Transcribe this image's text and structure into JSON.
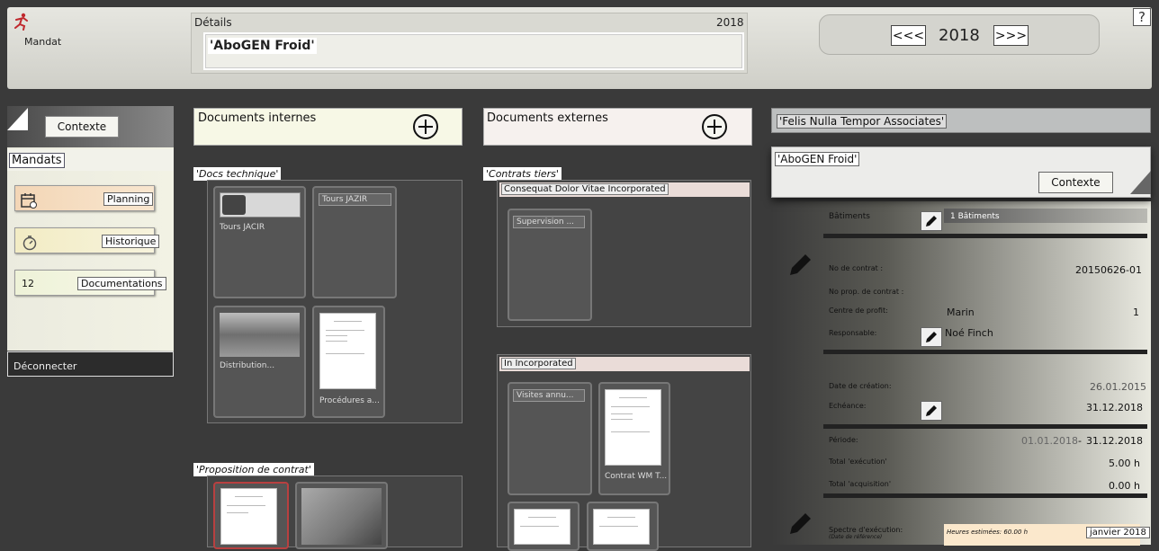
{
  "header": {
    "app_label": "Mandat",
    "details_title": "Détails",
    "details_year": "2018",
    "details_name": "'AboGEN Froid'",
    "nav_prev": "<<<",
    "nav_next": ">>>",
    "nav_year": "2018",
    "help": "?"
  },
  "sidebar": {
    "context_button": "Contexte",
    "mandats": "Mandats",
    "planning": "Planning",
    "historique": "Historique",
    "documentations_count": "12",
    "documentations": "Documentations",
    "logout": "Déconnecter"
  },
  "internal": {
    "title": "Documents internes",
    "group1": "'Docs technique'",
    "tiles": [
      "Tours JACIR",
      "Tours JAZIR",
      "Distribution...",
      "Procédures a..."
    ],
    "group2": "'Proposition de contrat'"
  },
  "external": {
    "title": "Documents externes",
    "group1": "'Contrats tiers'",
    "sub1": "Consequat Dolor Vitae Incorporated",
    "sub1_tile": "Supervision ...",
    "sub2": "In Incorporated",
    "sub2_tile1": "Visites annu...",
    "sub2_tile2": "Contrat WM T..."
  },
  "right": {
    "company": "'Felis Nulla Tempor Associates'",
    "mandate": "'AboGEN Froid'",
    "context_button": "Contexte",
    "batiments_label": "Bâtiments",
    "batiments_value": "1 Bâtiments",
    "no_contrat_label": "No de contrat :",
    "no_contrat_value": "20150626-01",
    "no_prop_label": "No prop. de contrat :",
    "centre_label": "Centre de profit:",
    "centre_name": "Marin",
    "centre_num": "1",
    "responsable_label": "Responsable:",
    "responsable_value": "Noé Finch",
    "creation_label": "Date de création:",
    "creation_value": "26.01.2015",
    "echeance_label": "Echéance:",
    "echeance_value": "31.12.2018",
    "periode_label": "Période:",
    "periode_start": "01.01.2018",
    "periode_sep": "-",
    "periode_end": "31.12.2018",
    "exec_label": "Total 'exécution'",
    "exec_value": "5.00 h",
    "acq_label": "Total 'acquisition'",
    "acq_value": "0.00 h",
    "spectre_label": "Spectre d'exécution:",
    "spectre_sub": "(Date de référence)",
    "heures_label": "Heures estimées: 60.00 h",
    "spectre_month": "janvier 2018"
  },
  "colors": {
    "background": "#3a3a3a",
    "planning": "#f3d6b6",
    "historique": "#f2ecc4",
    "documentations": "#eef2d8"
  }
}
